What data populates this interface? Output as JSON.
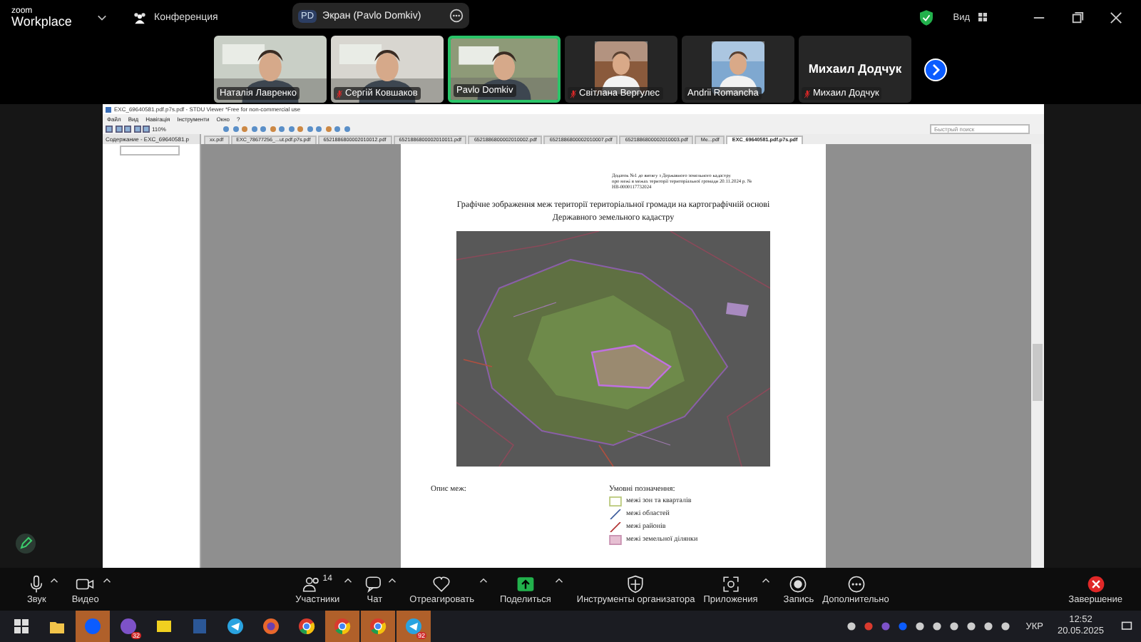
{
  "top_bar": {
    "logo_top": "zoom",
    "logo_bottom": "Workplace",
    "meeting_label": "Конференция",
    "share_pill": {
      "initials": "PD",
      "label": "Экран (Pavlo Domkiv)"
    },
    "view_label": "Вид"
  },
  "participants": [
    {
      "kind": "video",
      "name": "Наталія Лавренко",
      "muted": false,
      "selected": false,
      "color": "#c9cfc6"
    },
    {
      "kind": "video",
      "name": "Сергій Ковшаков",
      "muted": true,
      "selected": false,
      "color": "#d8d6d0"
    },
    {
      "kind": "video",
      "name": "Pavlo Domkiv",
      "muted": false,
      "selected": true,
      "color": "#8e9a78"
    },
    {
      "kind": "avatar",
      "name": "Світлана Вергулес",
      "muted": true,
      "selected": false,
      "color": "#8a5a3c"
    },
    {
      "kind": "avatar",
      "name": "Andrii Romancha",
      "muted": false,
      "selected": false,
      "color": "#7fa8d0"
    },
    {
      "kind": "name",
      "display_name": "Михаил Додчук",
      "name": "Михаил Додчук",
      "muted": true,
      "selected": false
    }
  ],
  "viewer": {
    "title": "EXC_69640581.pdf.p7s.pdf - STDU Viewer *Free for non-commercial use",
    "menu": [
      "Файл",
      "Вид",
      "Навігація",
      "Інструменти",
      "Окно",
      "?"
    ],
    "zoom": "110%",
    "search_placeholder": "Быстрый поиск",
    "panel_tab": "Содержание - EXC_69640581.p",
    "tabs": [
      {
        "label": "xx.pdf",
        "selected": false
      },
      {
        "label": "EXC_78677256_...ut.pdf.p7s.pdf",
        "selected": false
      },
      {
        "label": "6521886800002010012.pdf",
        "selected": false
      },
      {
        "label": "6521886800002010011.pdf",
        "selected": false
      },
      {
        "label": "6521886800002010002.pdf",
        "selected": false
      },
      {
        "label": "6521886800002010007.pdf",
        "selected": false
      },
      {
        "label": "6521886800002010003.pdf",
        "selected": false
      },
      {
        "label": "Ме...pdf",
        "selected": false
      },
      {
        "label": "EXC_69640581.pdf.p7s.pdf",
        "selected": true
      }
    ],
    "page": {
      "header_lines": [
        "Додаток №1 до витягу з Державного земельного кадастру",
        "про межі в межах території територіальної громади 20.11.2024 р. №",
        "НВ-0000117732024"
      ],
      "title_lines": [
        "Графічне зображення меж території територіальної громади на картографічній основі",
        "Державного земельного кадастру"
      ],
      "map": {
        "kind": "picture"
      },
      "description_label": "Опис меж:",
      "legend_title": "Умовні позначення:",
      "legend": [
        {
          "kind": "zone",
          "label": "межі зон та кварталів"
        },
        {
          "kind": "oblast",
          "label": "межі областей"
        },
        {
          "kind": "raion",
          "label": "межі районів"
        },
        {
          "kind": "parcel",
          "label": "межі земельної ділянки"
        }
      ]
    }
  },
  "toolbar": [
    {
      "kind": "mic",
      "label": "Звук",
      "caret": true
    },
    {
      "kind": "video",
      "label": "Видео",
      "caret": true
    },
    {
      "kind": "spacer"
    },
    {
      "kind": "people",
      "label": "Участники",
      "count": "14",
      "caret": true
    },
    {
      "kind": "chat",
      "label": "Чат",
      "caret": true
    },
    {
      "kind": "heart",
      "label": "Отреагировать",
      "caret": true
    },
    {
      "kind": "share",
      "label": "Поделиться",
      "caret": true
    },
    {
      "kind": "shield",
      "label": "Инструменты организатора",
      "caret": false
    },
    {
      "kind": "apps",
      "label": "Приложения",
      "caret": true
    },
    {
      "kind": "record",
      "label": "Запись",
      "caret": false
    },
    {
      "kind": "more",
      "label": "Дополнительно",
      "caret": false
    },
    {
      "kind": "spacer"
    },
    {
      "kind": "end",
      "label": "Завершение",
      "caret": false
    }
  ],
  "taskbar": {
    "apps": [
      {
        "kind": "start",
        "active": false
      },
      {
        "kind": "folder",
        "active": false
      },
      {
        "kind": "zoom",
        "active": true
      },
      {
        "kind": "viber",
        "active": false,
        "badge": "32"
      },
      {
        "kind": "yellow",
        "active": false
      },
      {
        "kind": "word",
        "active": false
      },
      {
        "kind": "telegram",
        "active": false
      },
      {
        "kind": "firefox",
        "active": false
      },
      {
        "kind": "chrome",
        "active": false
      },
      {
        "kind": "chrome",
        "active": true
      },
      {
        "kind": "chrome",
        "active": true
      },
      {
        "kind": "telegram",
        "active": true,
        "badge": "92"
      }
    ],
    "lang": "УКР",
    "time": "12:52",
    "date": "20.05.2025"
  }
}
